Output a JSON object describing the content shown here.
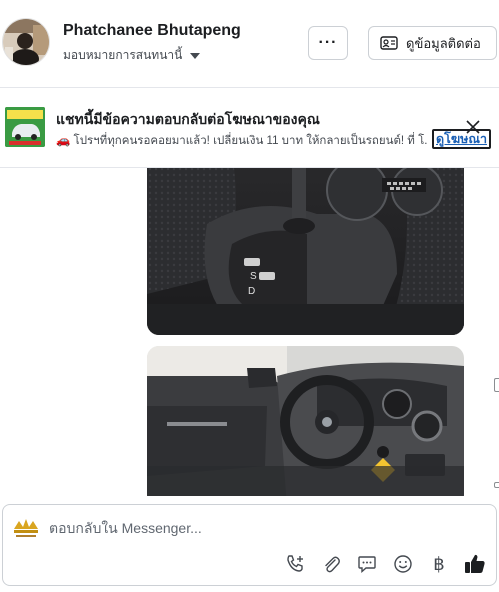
{
  "header": {
    "contact_name": "Phatchanee Bhutapeng",
    "assign_label": "มอบหมายการสนทนานี้",
    "more_label": "···",
    "contact_info_label": "ดูข้อมูลติดต่อ"
  },
  "ad_banner": {
    "title": "แชทนี้มีข้อความตอบกลับต่อโฆษณาของคุณ",
    "text": "🚗 โปรฯที่ทุกคนรอคอยมาแล้ว! เปลี่ยนเงิน 11 บาท ให้กลายเป็นรถยนต์! ที่ โ...",
    "view_ad_label": "ดูโฆษณา"
  },
  "composer": {
    "placeholder": "ตอบกลับใน Messenger...",
    "tools": [
      "phone-plus-icon",
      "paperclip-icon",
      "chat-bubble-icon",
      "smiley-icon",
      "baht-icon",
      "thumbs-up-icon"
    ],
    "baht_symbol": "฿"
  },
  "colors": {
    "accent": "#1a5fb4",
    "border": "#ccd0d5",
    "text": "#1c1e21"
  }
}
